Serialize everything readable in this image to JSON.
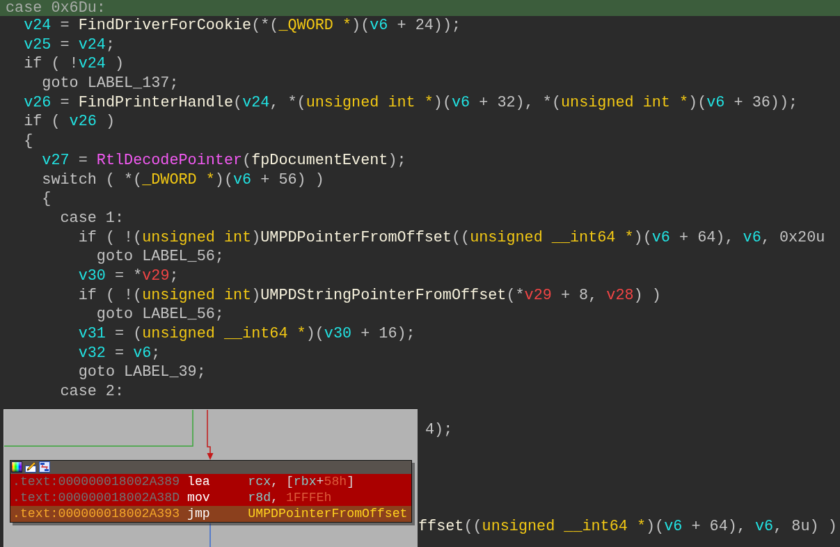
{
  "code_view": {
    "lines": [
      {
        "selected": true,
        "tokens": [
          {
            "kind": "plain",
            "text": "case 0x6Du:"
          }
        ],
        "children": [
          {
            "selected": false,
            "tokens": [
              {
                "kind": "variable",
                "text": "v24"
              },
              {
                "kind": "plain",
                "text": " = "
              },
              {
                "kind": "function",
                "text": "FindDriverForCookie"
              },
              {
                "kind": "plain",
                "text": "(*("
              },
              {
                "kind": "type",
                "text": "_QWORD *"
              },
              {
                "kind": "plain",
                "text": ")("
              },
              {
                "kind": "variable",
                "text": "v6"
              },
              {
                "kind": "plain",
                "text": " + 24));"
              }
            ]
          },
          {
            "selected": false,
            "tokens": [
              {
                "kind": "variable",
                "text": "v25"
              },
              {
                "kind": "plain",
                "text": " = "
              },
              {
                "kind": "variable",
                "text": "v24"
              },
              {
                "kind": "plain",
                "text": ";"
              }
            ]
          },
          {
            "selected": false,
            "tokens": [
              {
                "kind": "plain",
                "text": "if ( !"
              },
              {
                "kind": "variable",
                "text": "v24"
              },
              {
                "kind": "plain",
                "text": " )"
              }
            ],
            "children": [
              {
                "selected": false,
                "tokens": [
                  {
                    "kind": "plain",
                    "text": "goto LABEL_137;"
                  }
                ]
              }
            ]
          },
          {
            "selected": false,
            "tokens": [
              {
                "kind": "variable",
                "text": "v26"
              },
              {
                "kind": "plain",
                "text": " = "
              },
              {
                "kind": "function",
                "text": "FindPrinterHandle"
              },
              {
                "kind": "plain",
                "text": "("
              },
              {
                "kind": "variable",
                "text": "v24"
              },
              {
                "kind": "plain",
                "text": ", *("
              },
              {
                "kind": "type",
                "text": "unsigned int *"
              },
              {
                "kind": "plain",
                "text": ")("
              },
              {
                "kind": "variable",
                "text": "v6"
              },
              {
                "kind": "plain",
                "text": " + 32), *("
              },
              {
                "kind": "type",
                "text": "unsigned int *"
              },
              {
                "kind": "plain",
                "text": ")("
              },
              {
                "kind": "variable",
                "text": "v6"
              },
              {
                "kind": "plain",
                "text": " + 36));"
              }
            ]
          },
          {
            "selected": false,
            "tokens": [
              {
                "kind": "plain",
                "text": "if ( "
              },
              {
                "kind": "variable",
                "text": "v26"
              },
              {
                "kind": "plain",
                "text": " )"
              }
            ]
          },
          {
            "selected": false,
            "tokens": [
              {
                "kind": "plain",
                "text": "{"
              }
            ],
            "children": [
              {
                "selected": false,
                "tokens": [
                  {
                    "kind": "variable",
                    "text": "v27"
                  },
                  {
                    "kind": "plain",
                    "text": " = "
                  },
                  {
                    "kind": "api",
                    "text": "RtlDecodePointer"
                  },
                  {
                    "kind": "plain",
                    "text": "("
                  },
                  {
                    "kind": "function",
                    "text": "fpDocumentEvent"
                  },
                  {
                    "kind": "plain",
                    "text": ");"
                  }
                ]
              },
              {
                "selected": false,
                "tokens": [
                  {
                    "kind": "plain",
                    "text": "switch ( *("
                  },
                  {
                    "kind": "type",
                    "text": "_DWORD *"
                  },
                  {
                    "kind": "plain",
                    "text": ")("
                  },
                  {
                    "kind": "variable",
                    "text": "v6"
                  },
                  {
                    "kind": "plain",
                    "text": " + 56) )"
                  }
                ]
              },
              {
                "selected": false,
                "tokens": [
                  {
                    "kind": "plain",
                    "text": "{"
                  }
                ],
                "children": [
                  {
                    "selected": false,
                    "tokens": [
                      {
                        "kind": "plain",
                        "text": "case 1:"
                      }
                    ],
                    "children": [
                      {
                        "selected": false,
                        "tokens": [
                          {
                            "kind": "plain",
                            "text": "if ( !("
                          },
                          {
                            "kind": "type",
                            "text": "unsigned int"
                          },
                          {
                            "kind": "plain",
                            "text": ")"
                          },
                          {
                            "kind": "function",
                            "text": "UMPDPointerFromOffset"
                          },
                          {
                            "kind": "plain",
                            "text": "(("
                          },
                          {
                            "kind": "type",
                            "text": "unsigned __int64 *"
                          },
                          {
                            "kind": "plain",
                            "text": ")("
                          },
                          {
                            "kind": "variable",
                            "text": "v6"
                          },
                          {
                            "kind": "plain",
                            "text": " + 64), "
                          },
                          {
                            "kind": "variable",
                            "text": "v6"
                          },
                          {
                            "kind": "plain",
                            "text": ", 0x20u"
                          }
                        ],
                        "children": [
                          {
                            "selected": false,
                            "tokens": [
                              {
                                "kind": "plain",
                                "text": "goto LABEL_56;"
                              }
                            ]
                          }
                        ]
                      },
                      {
                        "selected": false,
                        "tokens": [
                          {
                            "kind": "variable",
                            "text": "v30"
                          },
                          {
                            "kind": "plain",
                            "text": " = *"
                          },
                          {
                            "kind": "argument",
                            "text": "v29"
                          },
                          {
                            "kind": "plain",
                            "text": ";"
                          }
                        ]
                      },
                      {
                        "selected": false,
                        "tokens": [
                          {
                            "kind": "plain",
                            "text": "if ( !("
                          },
                          {
                            "kind": "type",
                            "text": "unsigned int"
                          },
                          {
                            "kind": "plain",
                            "text": ")"
                          },
                          {
                            "kind": "function",
                            "text": "UMPDStringPointerFromOffset"
                          },
                          {
                            "kind": "plain",
                            "text": "(*"
                          },
                          {
                            "kind": "argument",
                            "text": "v29"
                          },
                          {
                            "kind": "plain",
                            "text": " + 8, "
                          },
                          {
                            "kind": "argument",
                            "text": "v28"
                          },
                          {
                            "kind": "plain",
                            "text": ") )"
                          }
                        ],
                        "children": [
                          {
                            "selected": false,
                            "tokens": [
                              {
                                "kind": "plain",
                                "text": "goto LABEL_56;"
                              }
                            ]
                          }
                        ]
                      },
                      {
                        "selected": false,
                        "tokens": [
                          {
                            "kind": "variable",
                            "text": "v31"
                          },
                          {
                            "kind": "plain",
                            "text": " = ("
                          },
                          {
                            "kind": "type",
                            "text": "unsigned __int64 *"
                          },
                          {
                            "kind": "plain",
                            "text": ")("
                          },
                          {
                            "kind": "variable",
                            "text": "v30"
                          },
                          {
                            "kind": "plain",
                            "text": " + 16);"
                          }
                        ]
                      },
                      {
                        "selected": false,
                        "tokens": [
                          {
                            "kind": "variable",
                            "text": "v32"
                          },
                          {
                            "kind": "plain",
                            "text": " = "
                          },
                          {
                            "kind": "variable",
                            "text": "v6"
                          },
                          {
                            "kind": "plain",
                            "text": ";"
                          }
                        ]
                      },
                      {
                        "selected": false,
                        "tokens": [
                          {
                            "kind": "plain",
                            "text": "goto LABEL_39;"
                          }
                        ]
                      }
                    ]
                  },
                  {
                    "selected": false,
                    "tokens": [
                      {
                        "kind": "plain",
                        "text": "case 2:"
                      }
                    ]
                  }
                ]
              }
            ]
          }
        ]
      }
    ],
    "line_tails": [
      {
        "selected": false,
        "tokens": [
          {
            "kind": "plain",
            "text": "4);"
          }
        ]
      },
      {
        "selected": false,
        "tokens": [
          {
            "kind": "function",
            "text": "ffset"
          },
          {
            "kind": "plain",
            "text": "(("
          },
          {
            "kind": "type",
            "text": "unsigned __int64 *"
          },
          {
            "kind": "plain",
            "text": ")("
          },
          {
            "kind": "variable",
            "text": "v6"
          },
          {
            "kind": "plain",
            "text": " + 64), "
          },
          {
            "kind": "variable",
            "text": "v6"
          },
          {
            "kind": "plain",
            "text": ", 8u) )"
          }
        ]
      }
    ]
  },
  "graph_preview": {
    "node": {
      "instructions": [
        {
          "selected": false,
          "address": ".text:000000018002A389",
          "mnemonic": "lea",
          "operands": [
            {
              "kind": "register",
              "text": "rcx"
            },
            {
              "kind": "punctuation",
              "text": ", ["
            },
            {
              "kind": "register",
              "text": "rbx"
            },
            {
              "kind": "punctuation",
              "text": "+"
            },
            {
              "kind": "number",
              "text": "58h"
            },
            {
              "kind": "punctuation",
              "text": "]"
            }
          ]
        },
        {
          "selected": false,
          "address": ".text:000000018002A38D",
          "mnemonic": "mov",
          "operands": [
            {
              "kind": "register",
              "text": "r8d"
            },
            {
              "kind": "punctuation",
              "text": ", "
            },
            {
              "kind": "number",
              "text": "1FFFEh"
            }
          ]
        },
        {
          "selected": true,
          "address": ".text:000000018002A393",
          "mnemonic": "jmp",
          "operands": [
            {
              "kind": "name",
              "text": "UMPDPointerFromOffset"
            }
          ]
        }
      ]
    }
  }
}
